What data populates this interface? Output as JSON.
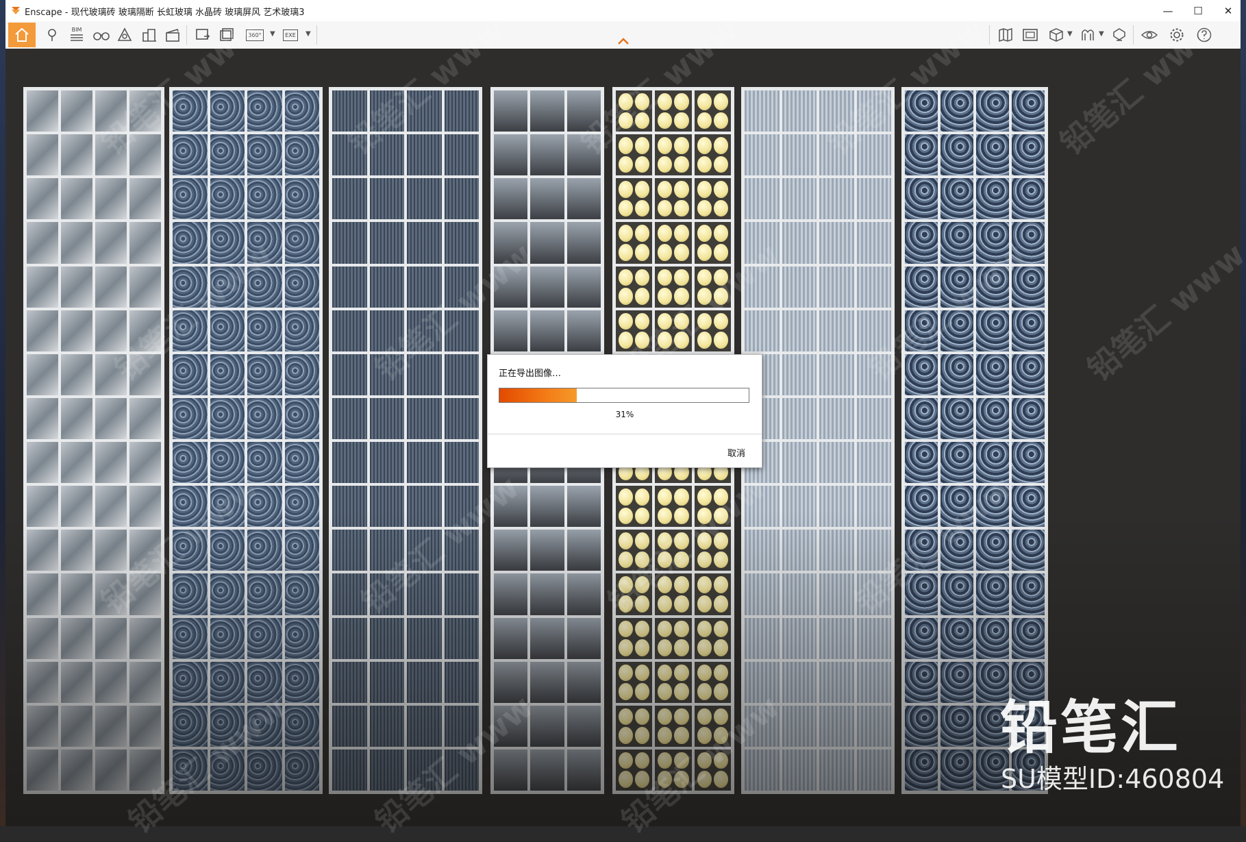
{
  "window": {
    "app_name": "Enscape",
    "title_separator": " - ",
    "document_title": "现代玻璃砖 玻璃隔断 长虹玻璃 水晶砖 玻璃屏风 艺术玻璃3",
    "minimize_glyph": "—",
    "maximize_glyph": "☐",
    "close_glyph": "✕"
  },
  "toolbar": {
    "bim_label": "BIM",
    "pano_label": "360°",
    "exe_label": "EXE",
    "left_icons": [
      "home-icon",
      "location-pin-icon",
      "bim-icon",
      "binoculars-icon",
      "light-view-icon",
      "buildings-icon",
      "clapper-icon",
      "screenshot-export-icon",
      "batch-export-icon",
      "panorama-export-icon",
      "exe-export-icon"
    ],
    "right_icons": [
      "map-icon",
      "capture-icon",
      "cube-icon",
      "asset-library-icon",
      "material-icon",
      "visual-settings-icon",
      "settings-icon",
      "help-icon"
    ]
  },
  "viewport": {
    "panels": [
      {
        "style": "pyramid",
        "cols": 4,
        "rows": 16
      },
      {
        "style": "crystal",
        "cols": 4,
        "rows": 16
      },
      {
        "style": "grid",
        "cols": 4,
        "rows": 16
      },
      {
        "style": "capsule",
        "cols": 3,
        "rows": 16
      },
      {
        "style": "dots",
        "cols": 3,
        "rows": 16
      },
      {
        "style": "reeded",
        "cols": 4,
        "rows": 16
      },
      {
        "style": "crystal-blue",
        "cols": 4,
        "rows": 16
      }
    ]
  },
  "export_dialog": {
    "title": "正在导出图像…",
    "progress": 0.31,
    "progress_label": "31%",
    "cancel_label": "取消"
  },
  "watermark": {
    "brand": "铅笔汇",
    "model_id": "SU模型ID:460804",
    "tile_text": "铅笔汇 www"
  },
  "colors": {
    "accent": "#f39a3a",
    "progress": "#f47b16"
  }
}
